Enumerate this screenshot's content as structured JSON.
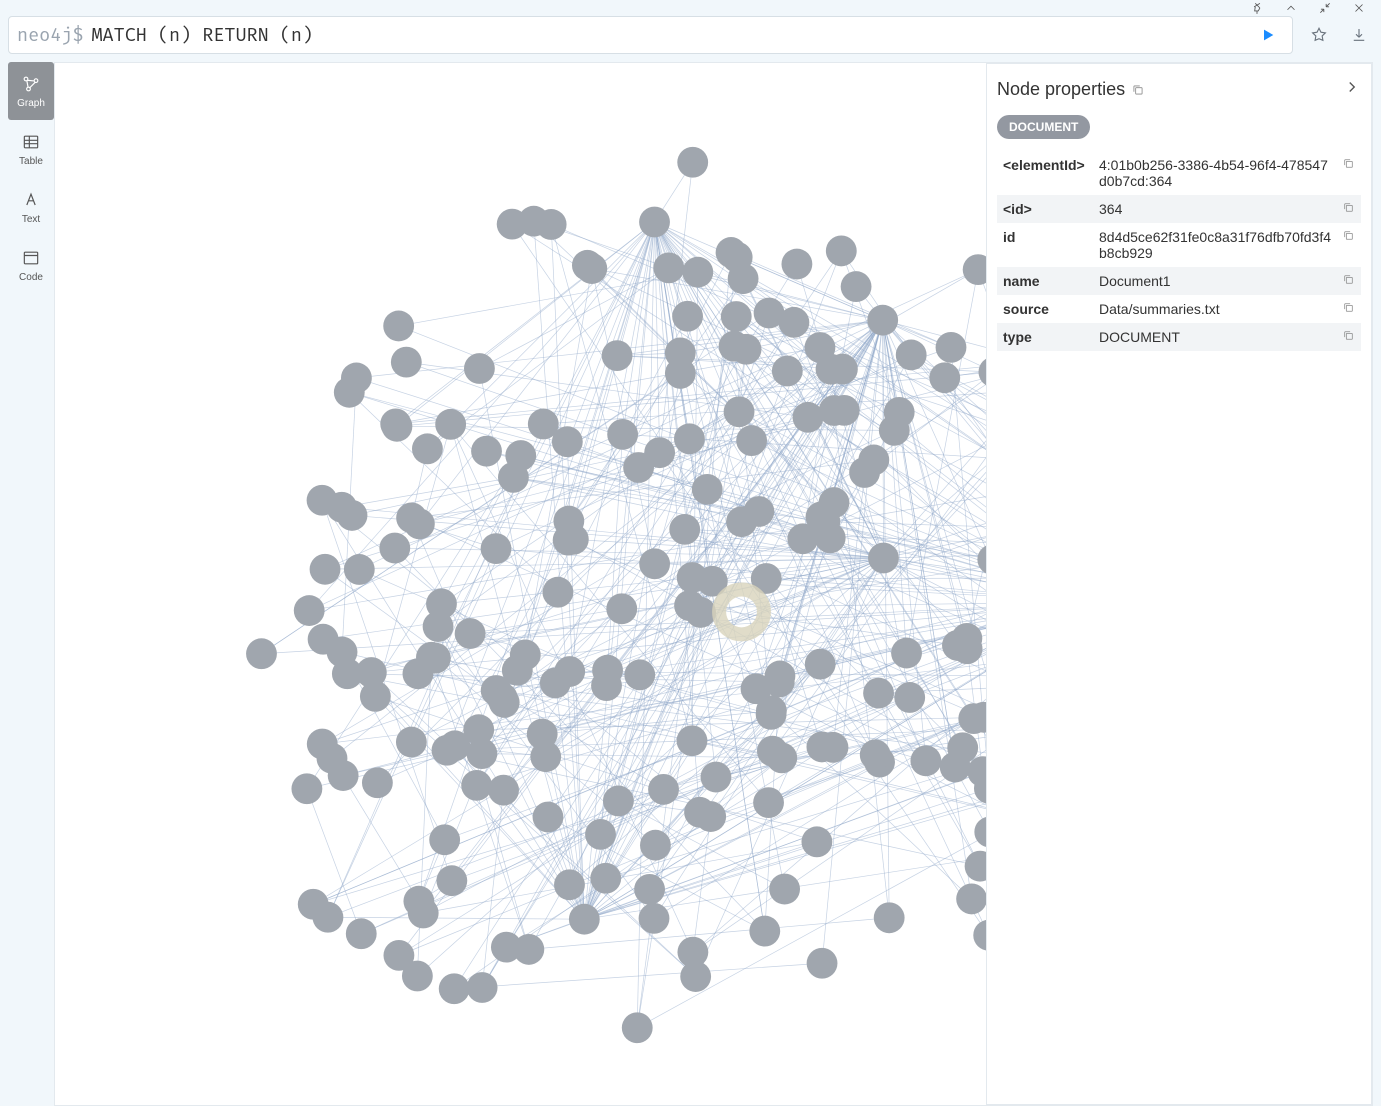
{
  "window_controls": {
    "pin": "pin",
    "up": "chevron-up",
    "collapse": "diagonal-in",
    "close": "x"
  },
  "query": {
    "prompt": "neo4j$",
    "text": "MATCH (n) RETURN (n)"
  },
  "view_tabs": [
    {
      "id": "graph",
      "label": "Graph",
      "active": true
    },
    {
      "id": "table",
      "label": "Table",
      "active": false
    },
    {
      "id": "text",
      "label": "Text",
      "active": false
    },
    {
      "id": "code",
      "label": "Code",
      "active": false
    }
  ],
  "properties_panel": {
    "title": "Node properties",
    "label_badge": "DOCUMENT",
    "rows": [
      {
        "key": "<elementId>",
        "value": "4:01b0b256-3386-4b54-96f4-478547d0b7cd:364"
      },
      {
        "key": "<id>",
        "value": "364"
      },
      {
        "key": "id",
        "value": "8d4d5ce62f31fe0c8a31f76dfb70fd3f4b8cb929"
      },
      {
        "key": "name",
        "value": "Document1"
      },
      {
        "key": "source",
        "value": "Data/summaries.txt"
      },
      {
        "key": "type",
        "value": "DOCUMENT"
      }
    ]
  },
  "zoom_controls": [
    "zoom-in",
    "zoom-out",
    "fit"
  ]
}
